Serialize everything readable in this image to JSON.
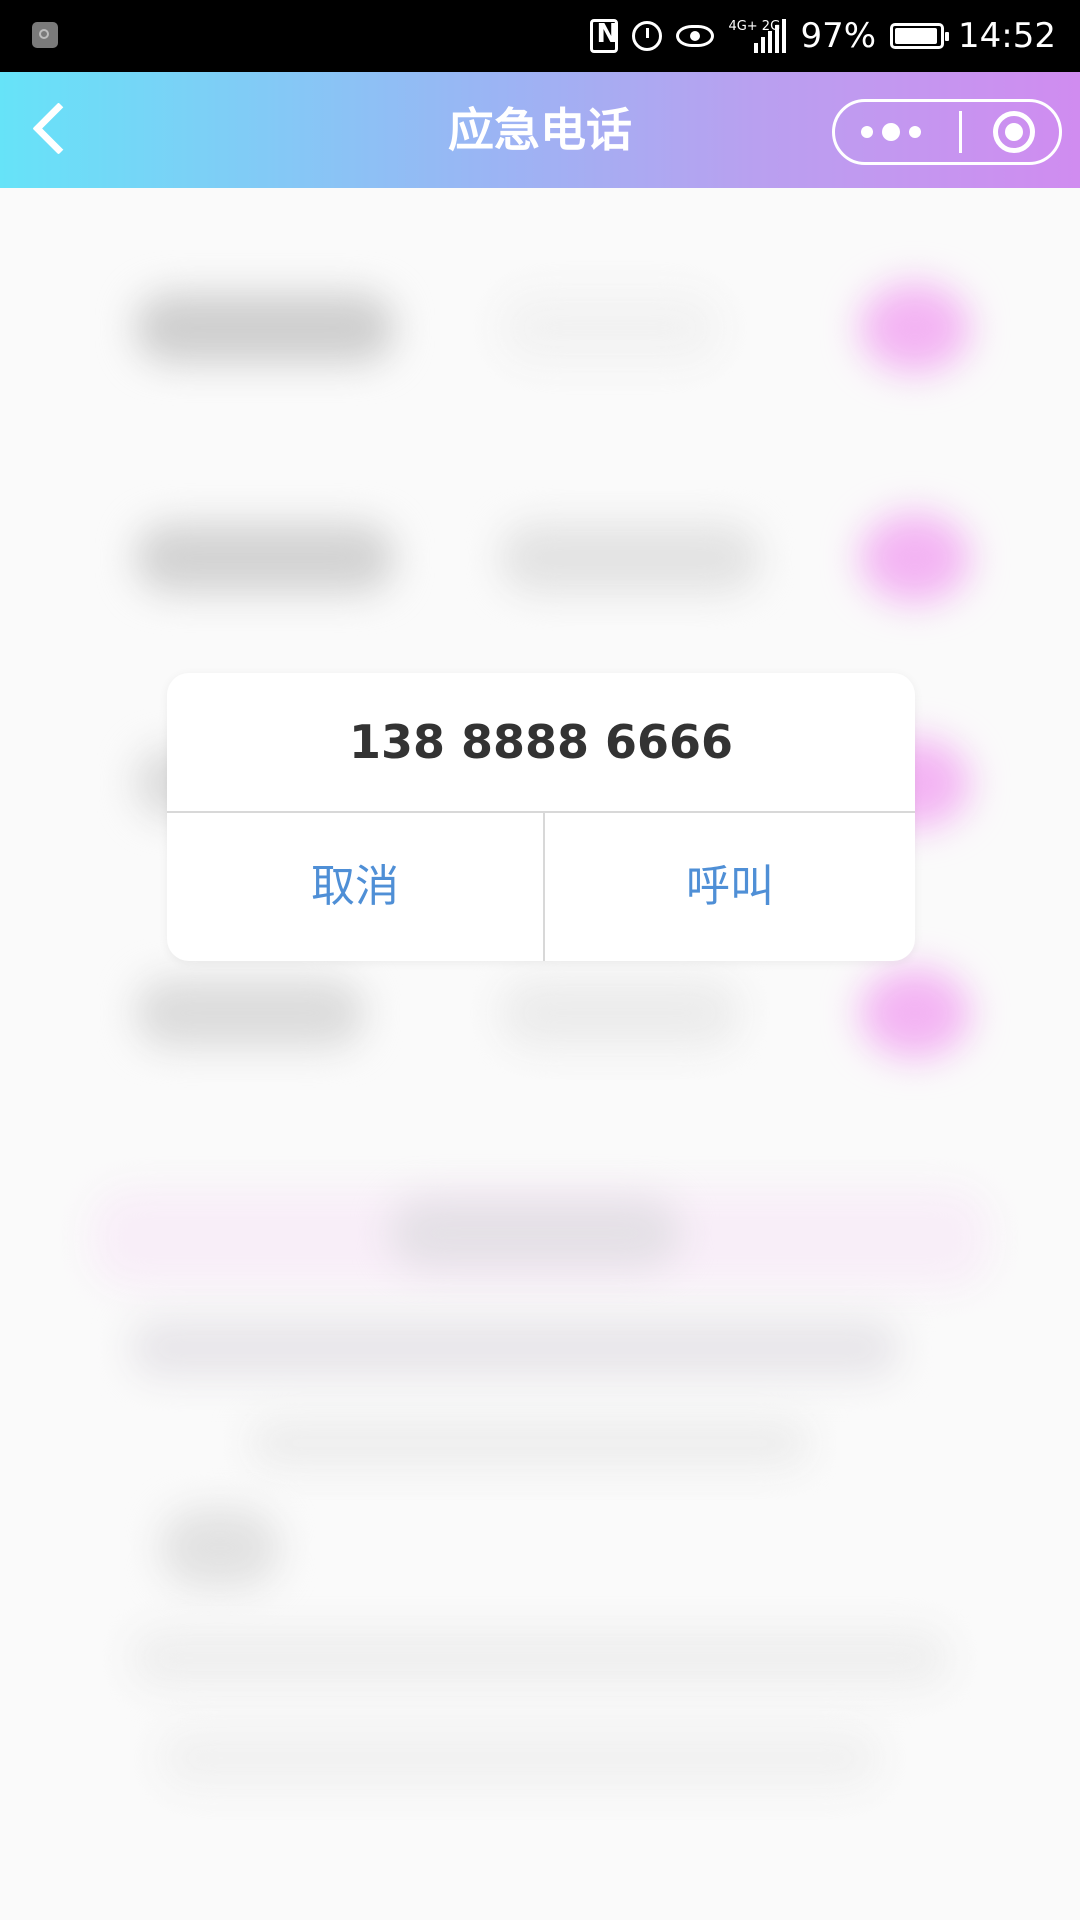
{
  "status_bar": {
    "signal_label": "4G+ 2G",
    "battery": "97%",
    "time": "14:52"
  },
  "header": {
    "title": "应急电话"
  },
  "dialog": {
    "phone_number": "138 8888 6666",
    "cancel_label": "取消",
    "call_label": "呼叫"
  },
  "colors": {
    "header_gradient_start": "#66e3f8",
    "header_gradient_end": "#d08cf0",
    "dialog_button_text": "#4f8fd6",
    "number_text": "#333333"
  }
}
